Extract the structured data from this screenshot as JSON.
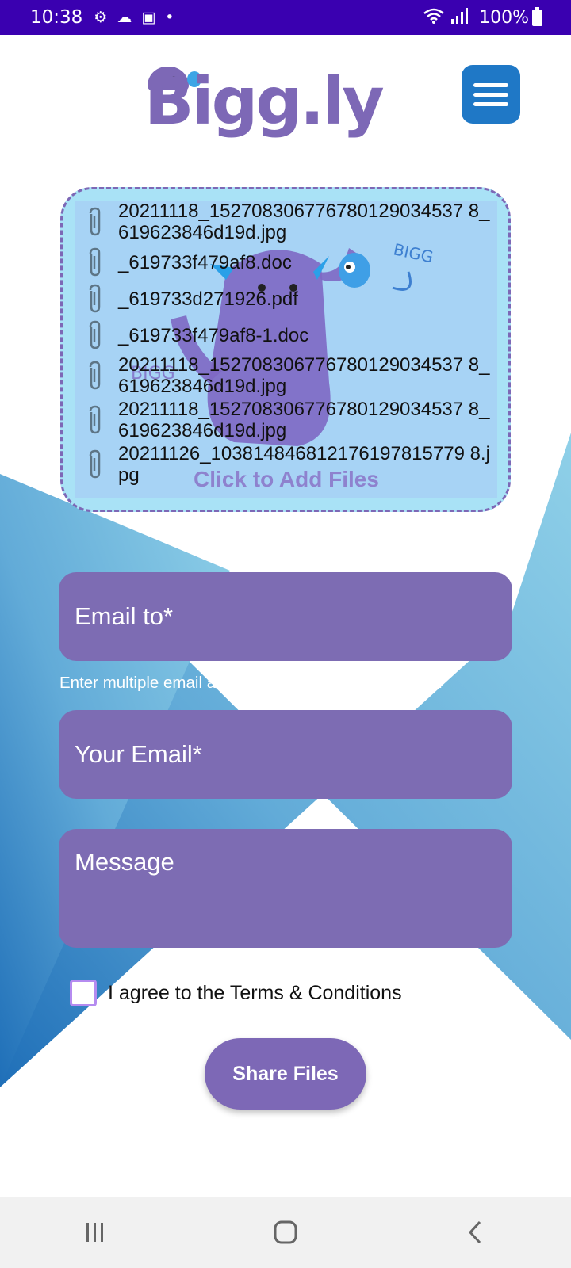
{
  "status_bar": {
    "time": "10:38",
    "battery": "100%",
    "icons": [
      "gear-icon",
      "cloud-icon",
      "bag-icon",
      "dot-icon",
      "wifi-icon",
      "signal-icon",
      "battery-icon"
    ]
  },
  "header": {
    "logo_text": "Bigg.ly",
    "menu_icon": "hamburger-icon"
  },
  "drop_zone": {
    "cta": "Click to Add Files",
    "files": [
      "20211118_152708306776780129034537 8_619623846d19d.jpg",
      "_619733f479af8.doc",
      "_619733d271926.pdf",
      "_619733f479af8-1.doc",
      "20211118_152708306776780129034537 8_619623846d19d.jpg",
      "20211118_152708306776780129034537 8_619623846d19d.jpg",
      "20211126_103814846812176197815779 8.jpg"
    ]
  },
  "form": {
    "email_to_placeholder": "Email to*",
    "email_hint": "Enter multiple email addresses separated by comma.",
    "your_email_placeholder": "Your Email*",
    "message_placeholder": "Message",
    "terms_label": "I agree to the Terms & Conditions",
    "terms_checked": false,
    "submit_label": "Share Files"
  },
  "nav_bar": {
    "buttons": [
      "recent-apps-icon",
      "home-icon",
      "back-icon"
    ]
  },
  "colors": {
    "status_bar": "#3a00b0",
    "brand_purple": "#7d68b6",
    "menu_blue": "#1f78c6",
    "drop_bg": "#a9e2f6"
  }
}
